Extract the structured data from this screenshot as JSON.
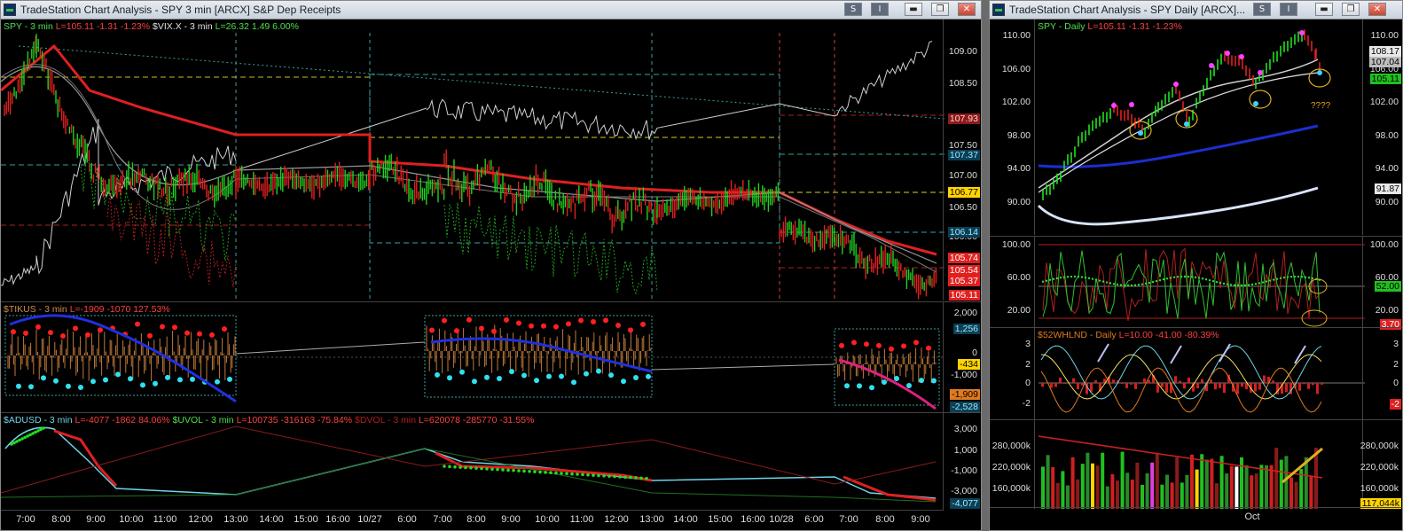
{
  "left": {
    "title": "TradeStation Chart Analysis - SPY 3 min [ARCX] S&P Dep Receipts",
    "s_btn": "S",
    "i_btn": "I",
    "spy_hdr": [
      {
        "text": "SPY - 3 min",
        "color": "#4de04d"
      },
      {
        "text": "L=105.11",
        "color": "#ff4040"
      },
      {
        "text": "-1.31",
        "color": "#ff4040"
      },
      {
        "text": "-1.23%",
        "color": "#ff4040"
      },
      {
        "text": "$VIX.X - 3 min",
        "color": "#e0e0e0"
      },
      {
        "text": "L=26.32",
        "color": "#4de04d"
      },
      {
        "text": "1.49",
        "color": "#4de04d"
      },
      {
        "text": "6.00%",
        "color": "#4de04d"
      }
    ],
    "spy_ticks": [
      "109.00",
      "108.50",
      "107.50",
      "107.00",
      "106.50",
      "106.00"
    ],
    "spy_badges": [
      {
        "text": "107.93",
        "bg": "#8b1a1a",
        "color": "#ffd0d0"
      },
      {
        "text": "107.37",
        "bg": "#0b3f55",
        "color": "#9fe8ff"
      },
      {
        "text": "106.77",
        "bg": "#ffd400",
        "color": "#000"
      },
      {
        "text": "106.14",
        "bg": "#0b3f55",
        "color": "#9fe8ff"
      },
      {
        "text": "105.74",
        "bg": "#e02020",
        "color": "#fff"
      },
      {
        "text": "105.54",
        "bg": "#e02020",
        "color": "#fff"
      },
      {
        "text": "105.37",
        "bg": "#e02020",
        "color": "#fff"
      },
      {
        "text": "105.11",
        "bg": "#e02020",
        "color": "#fff"
      }
    ],
    "tikus_hdr": [
      {
        "text": "$TIKUS - 3 min",
        "color": "#d08a4a"
      },
      {
        "text": "L=-1909",
        "color": "#ff4040"
      },
      {
        "text": "-1070",
        "color": "#ff4040"
      },
      {
        "text": "127.53%",
        "color": "#ff4040"
      }
    ],
    "tikus_ticks": [
      "2,000",
      "0",
      "-1,000"
    ],
    "tikus_badges": [
      {
        "text": "1,256",
        "bg": "#0b3f55",
        "color": "#9fe8ff"
      },
      {
        "text": "-434",
        "bg": "#ffd400",
        "color": "#000"
      },
      {
        "text": "-1,909",
        "bg": "#e07a20",
        "color": "#000"
      },
      {
        "text": "-2,528",
        "bg": "#0b3f55",
        "color": "#9fe8ff"
      }
    ],
    "adusd_hdr": [
      {
        "text": "$ADUSD - 3 min",
        "color": "#6fd4e8"
      },
      {
        "text": "L=-4077",
        "color": "#ff4040"
      },
      {
        "text": "-1862",
        "color": "#ff4040"
      },
      {
        "text": "84.06%",
        "color": "#ff4040"
      },
      {
        "text": "$UVOL - 3 min",
        "color": "#4de04d"
      },
      {
        "text": "L=100735",
        "color": "#ff4040"
      },
      {
        "text": "-316163",
        "color": "#ff4040"
      },
      {
        "text": "-75.84%",
        "color": "#ff4040"
      },
      {
        "text": "$DVOL - 3 min",
        "color": "#b02020"
      },
      {
        "text": "L=620078",
        "color": "#ff4040"
      },
      {
        "text": "-285770",
        "color": "#ff4040"
      },
      {
        "text": "-31.55%",
        "color": "#ff4040"
      }
    ],
    "adusd_ticks": [
      "3,000",
      "1,000",
      "-1,000",
      "-3,000"
    ],
    "adusd_badge": {
      "text": "-4,077",
      "bg": "#0b3f55",
      "color": "#9fe8ff"
    },
    "x_labels": [
      "7:00",
      "8:00",
      "9:00",
      "10:00",
      "11:00",
      "12:00",
      "13:00",
      "14:00",
      "15:00",
      "16:00",
      "10/27",
      "6:00",
      "7:00",
      "8:00",
      "9:00",
      "10:00",
      "11:00",
      "12:00",
      "13:00",
      "14:00",
      "15:00",
      "16:00",
      "10/28",
      "6:00",
      "7:00",
      "8:00",
      "9:00"
    ]
  },
  "right": {
    "title": "TradeStation Chart Analysis - SPY Daily [ARCX]...",
    "s_btn": "S",
    "i_btn": "I",
    "spy_hdr": [
      {
        "text": "SPY - Daily",
        "color": "#4de04d"
      },
      {
        "text": "L=105.11",
        "color": "#ff4040"
      },
      {
        "text": "-1.31",
        "color": "#ff4040"
      },
      {
        "text": "-1.23%",
        "color": "#ff4040"
      }
    ],
    "spy_ticks": [
      "110.00",
      "106.00",
      "102.00",
      "98.00",
      "94.00",
      "90.00"
    ],
    "spy_rticks": [
      "110.00",
      "106.00",
      "102.00",
      "98.00",
      "94.00",
      "90.00"
    ],
    "annotation": "????",
    "spy_badges": [
      {
        "text": "108.17",
        "bg": "#e8e8e8",
        "color": "#000"
      },
      {
        "text": "107.04",
        "bg": "#bdbdbd",
        "color": "#000"
      },
      {
        "text": "105.11",
        "bg": "#20c020",
        "color": "#000"
      },
      {
        "text": "91.87",
        "bg": "#e8e8e8",
        "color": "#000"
      }
    ],
    "osc_ticks": [
      "100.00",
      "60.00",
      "20.00"
    ],
    "osc_rticks": [
      "100.00",
      "60.00",
      "20.00"
    ],
    "osc_badges": [
      {
        "text": "52.00",
        "bg": "#20c020",
        "color": "#000"
      },
      {
        "text": "3.70",
        "bg": "#e02020",
        "color": "#fff"
      }
    ],
    "whl_hdr": [
      {
        "text": "$52WHLND - Daily",
        "color": "#e07a20"
      },
      {
        "text": "L=10.00",
        "color": "#ff4040"
      },
      {
        "text": "-41.00",
        "color": "#ff4040"
      },
      {
        "text": "-80.39%",
        "color": "#ff4040"
      }
    ],
    "whl_ticks": [
      "3",
      "2",
      "0",
      "-2"
    ],
    "whl_rticks": [
      "3",
      "2",
      "0"
    ],
    "whl_badge": {
      "text": "-2",
      "bg": "#e02020",
      "color": "#fff"
    },
    "vol_ticks": [
      "280,000k",
      "220,000k",
      "160,000k"
    ],
    "vol_rticks": [
      "280,000k",
      "220,000k",
      "160,000k"
    ],
    "vol_badge": {
      "text": "117,044k",
      "bg": "#ffd400",
      "color": "#000"
    },
    "x_label": "Oct"
  }
}
